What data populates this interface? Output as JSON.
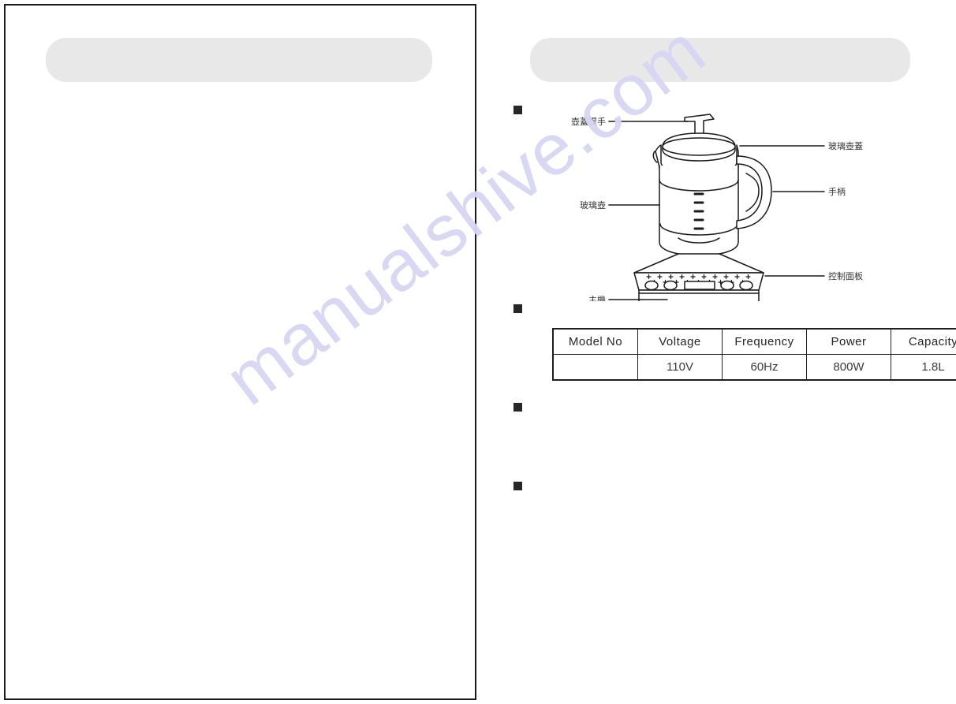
{
  "document": {
    "type": "instruction-manual-spread",
    "page_left": {
      "header_title": ""
    },
    "page_right": {
      "header_title": ""
    }
  },
  "bullets": [
    {
      "id": "bullet-1",
      "text": ""
    },
    {
      "id": "bullet-2",
      "text": ""
    },
    {
      "id": "bullet-3",
      "text": ""
    },
    {
      "id": "bullet-4",
      "text": ""
    }
  ],
  "diagram": {
    "name": "health-pot-parts-diagram",
    "callouts": {
      "lid_handle": "壺蓋提手",
      "glass_lid": "玻璃壺蓋",
      "glass_pot": "玻璃壺",
      "handle": "手柄",
      "control_panel": "控制面板",
      "main_unit": "主機"
    }
  },
  "spec_table": {
    "headers": [
      "Model No",
      "Voltage",
      "Frequency",
      "Power",
      "Capacity"
    ],
    "rows": [
      [
        "",
        "110V",
        "60Hz",
        "800W",
        "1.8L"
      ]
    ]
  },
  "watermark": {
    "text": "manualshive.com",
    "color": "#d8d6f4"
  },
  "colors": {
    "banner_gray": "#e8e8e8",
    "bullet_dark": "#262626",
    "line_black": "#1a1a1a",
    "watermark_lavender": "#d8d6f4"
  }
}
